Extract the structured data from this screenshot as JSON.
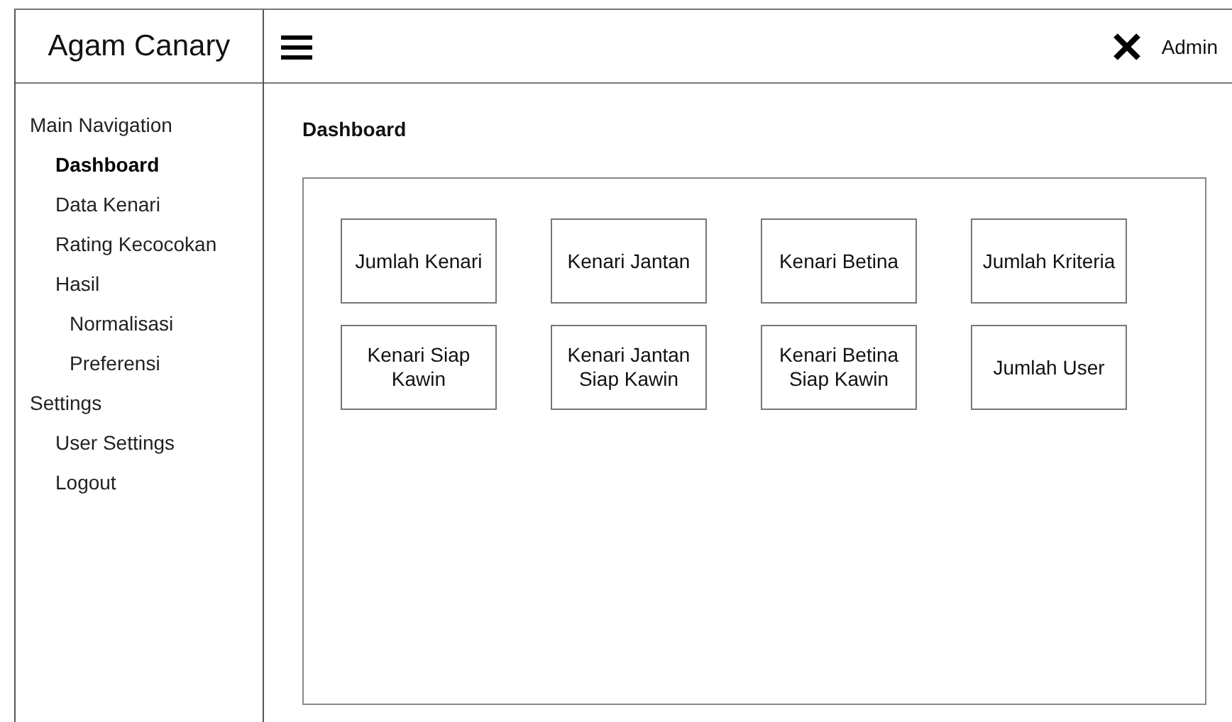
{
  "brand": "Agam Canary",
  "user": "Admin",
  "sidebar": {
    "items": [
      {
        "label": "Main Navigation",
        "selected": false,
        "children": [
          {
            "label": "Dashboard",
            "selected": true
          },
          {
            "label": "Data Kenari",
            "selected": false
          },
          {
            "label": "Rating Kecocokan",
            "selected": false
          },
          {
            "label": "Hasil",
            "selected": false,
            "children": [
              {
                "label": "Normalisasi",
                "selected": false
              },
              {
                "label": "Preferensi",
                "selected": false
              }
            ]
          }
        ]
      },
      {
        "label": "Settings",
        "selected": false,
        "children": [
          {
            "label": "User Settings",
            "selected": false
          },
          {
            "label": "Logout",
            "selected": false
          }
        ]
      }
    ]
  },
  "page_title": "Dashboard",
  "cards": [
    {
      "label": "Jumlah Kenari"
    },
    {
      "label": "Kenari Jantan"
    },
    {
      "label": "Kenari Betina"
    },
    {
      "label": "Jumlah Kriteria"
    },
    {
      "label": "Kenari Siap\nKawin"
    },
    {
      "label": "Kenari Jantan\nSiap Kawin"
    },
    {
      "label": "Kenari Betina\nSiap Kawin"
    },
    {
      "label": "Jumlah User"
    }
  ]
}
